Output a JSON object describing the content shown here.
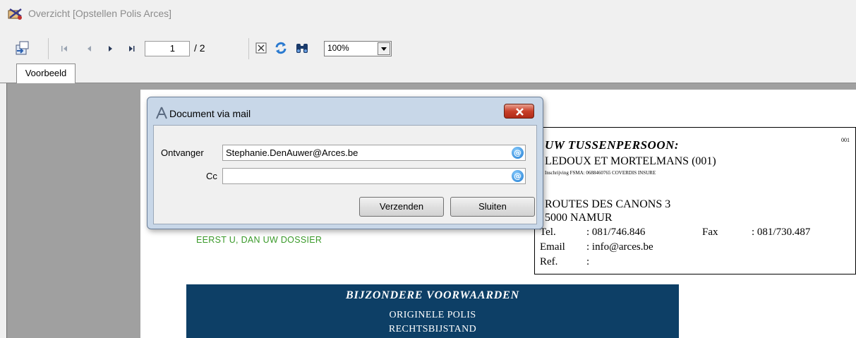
{
  "window": {
    "title": "Overzicht [Opstellen Polis Arces]"
  },
  "toolbar": {
    "current_page": "1",
    "page_total": "/ 2",
    "zoom": "100%"
  },
  "tabs": [
    {
      "label": "Voorbeeld"
    }
  ],
  "document": {
    "tagline": "EERST U, DAN UW DOSSIER",
    "agent": {
      "number": "001",
      "heading": "UW TUSSENPERSOON:",
      "name": "LEDOUX ET MORTELMANS (001)",
      "fsma": "Inschrijving FSMA: 0688460765 COVERDIS INSURE",
      "street": "ROUTES DES CANONS 3",
      "city": "5000 NAMUR",
      "tel_label": "Tel.",
      "tel": ": 081/746.846",
      "fax_label": "Fax",
      "fax": ": 081/730.487",
      "email_label": "Email",
      "email": ": info@arces.be",
      "ref_label": "Ref.",
      "ref": ":"
    },
    "banner": {
      "title": "BIJZONDERE VOORWAARDEN",
      "line1": "ORIGINELE POLIS",
      "line2": "RECHTSBIJSTAND"
    }
  },
  "dialog": {
    "title": "Document via mail",
    "recipient_label": "Ontvanger",
    "recipient_value": "Stephanie.DenAuwer@Arces.be",
    "cc_label": "Cc",
    "cc_value": "",
    "at_symbol": "@",
    "send_label": "Verzenden",
    "close_label": "Sluiten"
  },
  "colors": {
    "banner_bg": "#0d3f66",
    "tagline": "#3a9a2a",
    "dialog_frame": "#c8d7e8",
    "close_button": "#c8402a"
  },
  "icons": [
    "app-icon",
    "export-icon",
    "first-page-icon",
    "previous-page-icon",
    "next-page-icon",
    "last-page-icon",
    "close-preview-icon",
    "refresh-icon",
    "find-icon",
    "dropdown-arrow-icon",
    "dialog-app-icon",
    "close-icon",
    "address-book-icon"
  ]
}
